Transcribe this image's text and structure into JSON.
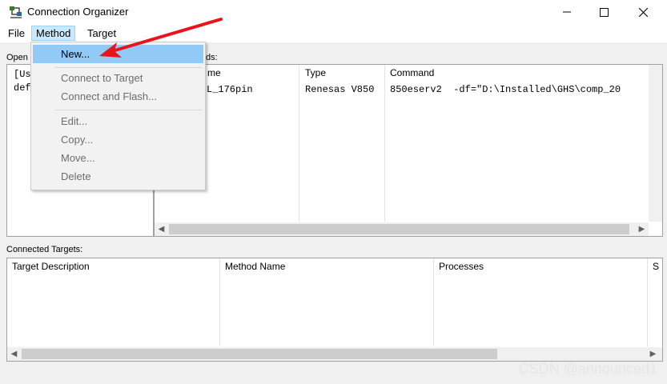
{
  "window": {
    "title": "Connection Organizer",
    "icons": {
      "app": "network-connection-icon",
      "minimize": "minimize-icon",
      "maximize": "maximize-icon",
      "close": "close-icon"
    }
  },
  "menubar": {
    "file": "File",
    "method": "Method",
    "target": "Target"
  },
  "method_menu": {
    "items": [
      {
        "label": "New...",
        "enabled": true,
        "highlighted": true
      },
      {
        "label": "Connect to Target",
        "enabled": false
      },
      {
        "label": "Connect and Flash...",
        "enabled": false
      },
      {
        "label": "Edit...",
        "enabled": false
      },
      {
        "label": "Copy...",
        "enabled": false
      },
      {
        "label": "Move...",
        "enabled": false
      },
      {
        "label": "Delete",
        "enabled": false
      }
    ]
  },
  "open_panel": {
    "label": "Open",
    "rows": [
      "[Us",
      "def"
    ]
  },
  "methods_panel": {
    "label_partial": "ds:",
    "columns": [
      "me",
      "Type",
      "Command"
    ],
    "rows": [
      {
        "name": "L_176pin",
        "type": "Renesas V850",
        "command": "850eserv2  -df=\"D:\\Installed\\GHS\\comp_20"
      }
    ]
  },
  "connected_targets": {
    "label": "Connected Targets:",
    "columns": [
      "Target Description",
      "Method Name",
      "Processes",
      "S"
    ]
  },
  "watermark": "CSDN @announced1",
  "annotation": {
    "arrow_color": "#e8141a"
  }
}
